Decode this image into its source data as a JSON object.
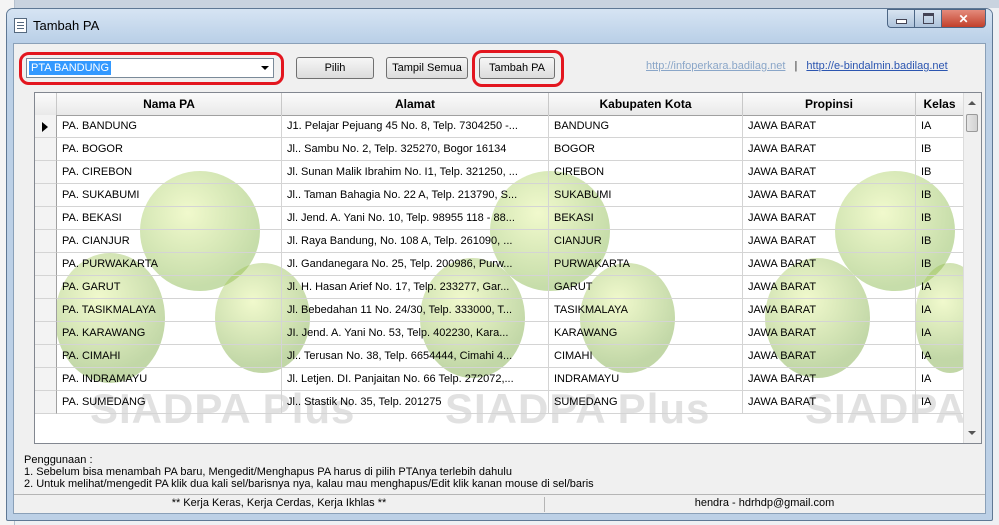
{
  "window": {
    "title": "Tambah PA"
  },
  "toolbar": {
    "combo_value": "PTA BANDUNG",
    "pilih": "Pilih",
    "tampil_semua": "Tampil Semua",
    "tambah_pa": "Tambah PA",
    "link1": "http://infoperkara.badilag.net",
    "separator": "|",
    "link2": "http://e-bindalmin.badilag.net"
  },
  "table": {
    "columns": [
      "Nama PA",
      "Alamat",
      "Kabupaten Kota",
      "Propinsi",
      "Kelas"
    ],
    "rows": [
      [
        "PA. BANDUNG",
        "J1. Pelajar Pejuang 45 No. 8, Telp. 7304250 -...",
        "BANDUNG",
        "JAWA BARAT",
        "IA"
      ],
      [
        "PA. BOGOR",
        "Jl.. Sambu No. 2, Telp. 325270, Bogor 16134",
        "BOGOR",
        "JAWA BARAT",
        "IB"
      ],
      [
        "PA. CIREBON",
        "Jl. Sunan Malik Ibrahim No. I1, Telp. 321250, ...",
        "CIREBON",
        "JAWA BARAT",
        "IB"
      ],
      [
        "PA. SUKABUMI",
        "Jl.. Taman Bahagia No. 22 A, Telp. 213790, S...",
        "SUKABUMI",
        "JAWA BARAT",
        "IB"
      ],
      [
        "PA. BEKASI",
        "Jl. Jend. A. Yani No. 10, Telp. 98955 118 - 88...",
        "BEKASI",
        "JAWA BARAT",
        "IB"
      ],
      [
        "PA. CIANJUR",
        "Jl. Raya Bandung, No. 108 A, Telp. 261090, ...",
        "CIANJUR",
        "JAWA BARAT",
        "IB"
      ],
      [
        "PA. PURWAKARTA",
        "Jl. Gandanegara No. 25, Telp. 200986, Purw...",
        "PURWAKARTA",
        "JAWA BARAT",
        "IB"
      ],
      [
        "PA. GARUT",
        "Jl. H. Hasan Arief No. 17, Telp.  233277, Gar...",
        "GARUT",
        "JAWA BARAT",
        "IA"
      ],
      [
        "PA. TASIKMALAYA",
        "Jl.  Bebedahan 11 No. 24/30, Telp. 333000, T...",
        "TASIKMALAYA",
        "JAWA BARAT",
        "IA"
      ],
      [
        "PA. KARAWANG",
        "JI. Jend. A. Yani No. 53, Telp. 402230, Kara...",
        "KARAWANG",
        "JAWA BARAT",
        "IA"
      ],
      [
        "PA. CIMAHI",
        "Jl.. Terusan No. 38, Telp. 6654444, Cimahi 4...",
        "CIMAHI",
        "JAWA BARAT",
        "IA"
      ],
      [
        "PA. INDRAMAYU",
        "Jl. Letjen. DI. Panjaitan No. 66 Telp. 272072,...",
        "INDRAMAYU",
        "JAWA BARAT",
        "IA"
      ],
      [
        "PA. SUMEDANG",
        "Jl.. Stastik No. 35, Telp. 201275",
        "SUMEDANG",
        "JAWA BARAT",
        "IA"
      ]
    ]
  },
  "watermark": {
    "text1": "SIADPA Plus",
    "text2": "SIADPA Plus",
    "text3": "SIADPA"
  },
  "notes": {
    "title": "Penggunaan :",
    "line1": "1. Sebelum bisa menambah PA baru, Mengedit/Menghapus PA harus di pilih PTAnya terlebih dahulu",
    "line2": "2. Untuk melihat/mengedit PA klik dua kali sel/barisnya nya, kalau mau menghapus/Edit klik kanan mouse di sel/baris"
  },
  "status": {
    "left": "** Kerja Keras, Kerja Cerdas, Kerja Ikhlas **",
    "right": "hendra - hdrhdp@gmail.com"
  },
  "colors": {
    "highlight": "#e3161f",
    "selection": "#3399ff",
    "watermark_green": "#6aa51e"
  }
}
